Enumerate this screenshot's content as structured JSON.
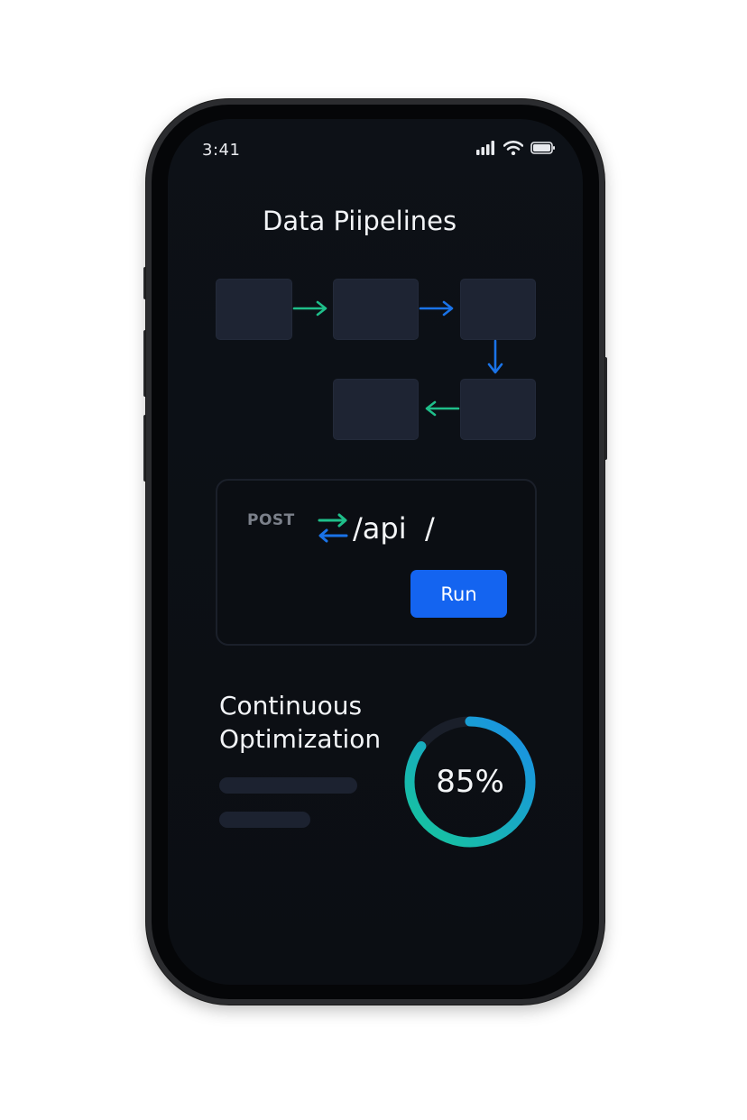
{
  "status_bar": {
    "time": "3:41",
    "signal_icon": "cellular-signal-icon",
    "wifi_icon": "wifi-icon",
    "battery_icon": "battery-icon"
  },
  "header": {
    "title": "Data Piipelines"
  },
  "pipeline": {
    "colors": {
      "green": "#1fbf8a",
      "blue": "#1a73e8",
      "node": "#1e2433"
    }
  },
  "api_card": {
    "method": "POST",
    "endpoint": "/api  /",
    "swap_icon": "swap-arrows-icon",
    "run_label": "Run",
    "accent": "#1464f0"
  },
  "optimization": {
    "title_line1": "Continuous",
    "title_line2": "Optimization",
    "progress_label": "85%",
    "progress_value": 0.85,
    "gradient_start": "#16c79a",
    "gradient_end": "#1a8ee8"
  }
}
